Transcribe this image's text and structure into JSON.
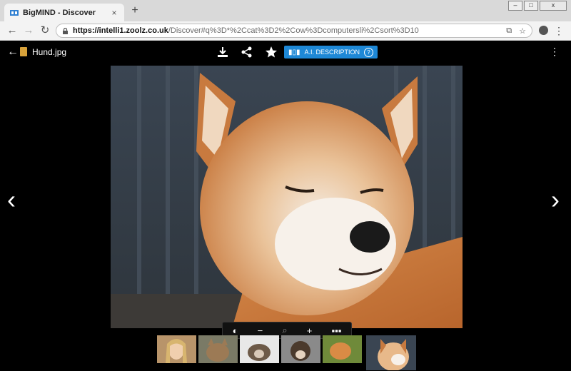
{
  "browser": {
    "tab_title": "BigMIND - Discover",
    "tab_close": "×",
    "new_tab": "+",
    "window_controls": [
      "–",
      "□",
      "x"
    ],
    "url_host": "https://intelli1.zoolz.co.uk",
    "url_path": "/Discover#q%3D*%2Ccat%3D2%2Cow%3Dcomputersli%2Csort%3D10"
  },
  "viewer": {
    "file_name": "Hund.jpg",
    "ai_button_label": "A.I. DESCRIPTION",
    "ai_help": "?",
    "icons": [
      "back-arrow-icon",
      "image-file-icon",
      "download-icon",
      "share-icon",
      "star-icon",
      "kebab-icon",
      "contrast-icon",
      "zoom-out-icon",
      "zoom-icon",
      "zoom-in-icon",
      "more-icon",
      "prev-arrow-icon",
      "next-arrow-icon"
    ]
  },
  "thumbnails": [
    {
      "name": "thumb-girl"
    },
    {
      "name": "thumb-cat-1"
    },
    {
      "name": "thumb-guinea-pig"
    },
    {
      "name": "thumb-puppy"
    },
    {
      "name": "thumb-cat-2"
    },
    {
      "name": "thumb-shiba",
      "active": true
    }
  ]
}
